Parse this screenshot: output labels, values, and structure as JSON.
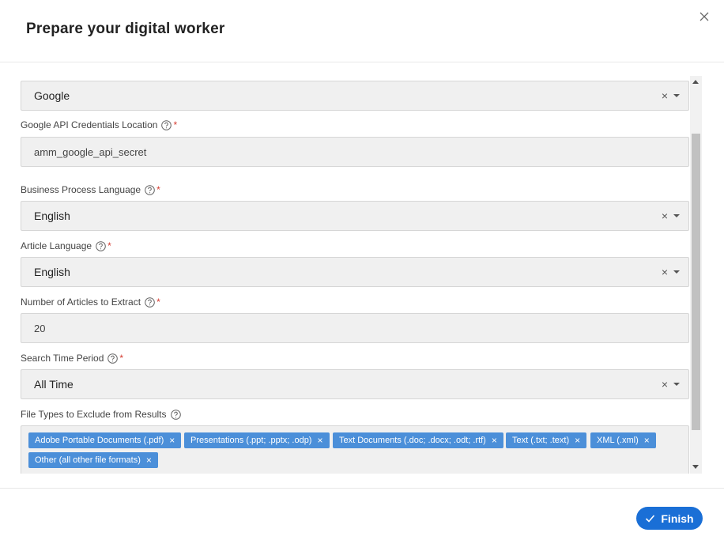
{
  "modal": {
    "title": "Prepare your digital worker",
    "close_icon": "close-icon"
  },
  "fields": {
    "search_engine": {
      "value": "Google"
    },
    "credentials": {
      "label": "Google API Credentials Location",
      "value": "amm_google_api_secret",
      "required": "*"
    },
    "bp_language": {
      "label": "Business Process Language",
      "value": "English",
      "required": "*"
    },
    "article_language": {
      "label": "Article Language",
      "value": "English",
      "required": "*"
    },
    "num_articles": {
      "label": "Number of Articles to Extract",
      "value": "20",
      "required": "*"
    },
    "time_period": {
      "label": "Search Time Period",
      "value": "All Time",
      "required": "*"
    },
    "file_types": {
      "label": "File Types to Exclude from Results",
      "tags": [
        "Adobe Portable Documents (.pdf)",
        "Presentations (.ppt; .pptx; .odp)",
        "Text Documents (.doc; .docx; .odt; .rtf)",
        "Text (.txt; .text)",
        "XML (.xml)",
        "Other (all other file formats)"
      ]
    }
  },
  "glyphs": {
    "clear": "×",
    "tag_remove": "×"
  },
  "footer": {
    "finish_label": "Finish"
  },
  "colors": {
    "accent": "#1a6fd6",
    "tag": "#4b8fd9",
    "required": "#d43a2f"
  }
}
